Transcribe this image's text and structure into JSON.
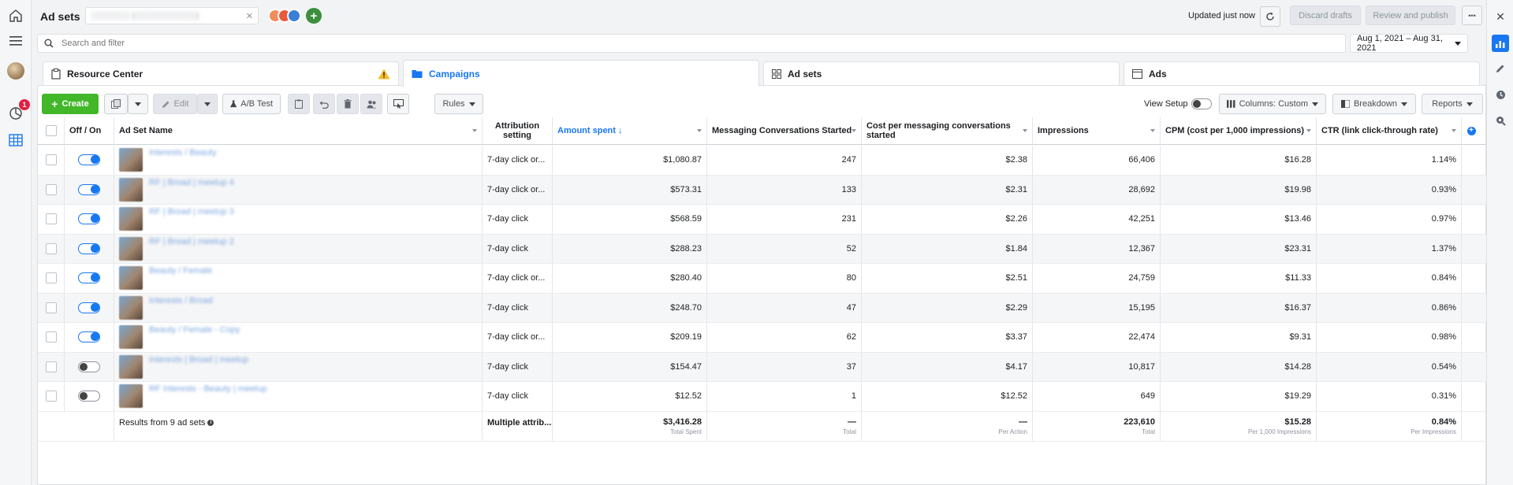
{
  "header": {
    "title": "Ad sets",
    "account_selector": "░░░░░░░ (░░░░░░░░░░░)",
    "updated_text": "Updated just now",
    "discard_label": "Discard drafts",
    "review_label": "Review and publish",
    "more_label": "•••"
  },
  "leftnav": {
    "notification_badge": "1"
  },
  "search": {
    "placeholder": "Search and filter"
  },
  "date_range": "Aug 1, 2021 – Aug 31, 2021",
  "tabs": [
    {
      "label": "Resource Center"
    },
    {
      "label": "Campaigns"
    },
    {
      "label": "Ad sets"
    },
    {
      "label": "Ads"
    }
  ],
  "toolbar": {
    "create_label": "Create",
    "edit_label": "Edit",
    "ab_test_label": "A/B Test",
    "rules_label": "Rules",
    "view_setup_label": "View Setup",
    "columns_label": "Columns: Custom",
    "breakdown_label": "Breakdown",
    "reports_label": "Reports"
  },
  "table": {
    "headers": {
      "off_on": "Off / On",
      "name": "Ad Set Name",
      "attribution": "Attribution setting",
      "amount": "Amount spent ↓",
      "messaging": "Messaging Conversations Started",
      "cost_per": "Cost per messaging conversations started",
      "impressions": "Impressions",
      "cpm": "CPM (cost per 1,000 impressions)",
      "ctr": "CTR (link click-through rate)"
    },
    "rows": [
      {
        "on": true,
        "name": "Interests / Beauty",
        "attribution": "7-day click or...",
        "amount": "$1,080.87",
        "messaging": "247",
        "cost_per": "$2.38",
        "impressions": "66,406",
        "cpm": "$16.28",
        "ctr": "1.14%"
      },
      {
        "on": true,
        "name": "RF | Broad | meetup 4",
        "attribution": "7-day click or...",
        "amount": "$573.31",
        "messaging": "133",
        "cost_per": "$2.31",
        "impressions": "28,692",
        "cpm": "$19.98",
        "ctr": "0.93%"
      },
      {
        "on": true,
        "name": "RF | Broad | meetup 3",
        "attribution": "7-day click",
        "amount": "$568.59",
        "messaging": "231",
        "cost_per": "$2.26",
        "impressions": "42,251",
        "cpm": "$13.46",
        "ctr": "0.97%"
      },
      {
        "on": true,
        "name": "RF | Broad | meetup 2",
        "attribution": "7-day click",
        "amount": "$288.23",
        "messaging": "52",
        "cost_per": "$1.84",
        "impressions": "12,367",
        "cpm": "$23.31",
        "ctr": "1.37%"
      },
      {
        "on": true,
        "name": "Beauty / Female",
        "attribution": "7-day click or...",
        "amount": "$280.40",
        "messaging": "80",
        "cost_per": "$2.51",
        "impressions": "24,759",
        "cpm": "$11.33",
        "ctr": "0.84%"
      },
      {
        "on": true,
        "name": "Interests / Broad",
        "attribution": "7-day click",
        "amount": "$248.70",
        "messaging": "47",
        "cost_per": "$2.29",
        "impressions": "15,195",
        "cpm": "$16.37",
        "ctr": "0.86%"
      },
      {
        "on": true,
        "name": "Beauty / Female - Copy",
        "attribution": "7-day click or...",
        "amount": "$209.19",
        "messaging": "62",
        "cost_per": "$3.37",
        "impressions": "22,474",
        "cpm": "$9.31",
        "ctr": "0.98%"
      },
      {
        "on": false,
        "name": "Interests | Broad | meetup",
        "attribution": "7-day click",
        "amount": "$154.47",
        "messaging": "37",
        "cost_per": "$4.17",
        "impressions": "10,817",
        "cpm": "$14.28",
        "ctr": "0.54%"
      },
      {
        "on": false,
        "name": "RF Interests - Beauty | meetup",
        "attribution": "7-day click",
        "amount": "$12.52",
        "messaging": "1",
        "cost_per": "$12.52",
        "impressions": "649",
        "cpm": "$19.29",
        "ctr": "0.31%"
      }
    ],
    "totals": {
      "label": "Results from 9 ad sets",
      "attribution": "Multiple attrib...",
      "amount": "$3,416.28",
      "amount_sub": "Total Spent",
      "messaging": "—",
      "messaging_sub": "Total",
      "cost_per": "—",
      "cost_per_sub": "Per Action",
      "impressions": "223,610",
      "impressions_sub": "Total",
      "cpm": "$15.28",
      "cpm_sub": "Per 1,000 Impressions",
      "ctr": "0.84%",
      "ctr_sub": "Per Impressions"
    }
  },
  "colors": {
    "brand_blue": "#1877f2",
    "create_green": "#42b72a",
    "badge_red": "#e41e3f",
    "warning_yellow": "#f7b928"
  }
}
